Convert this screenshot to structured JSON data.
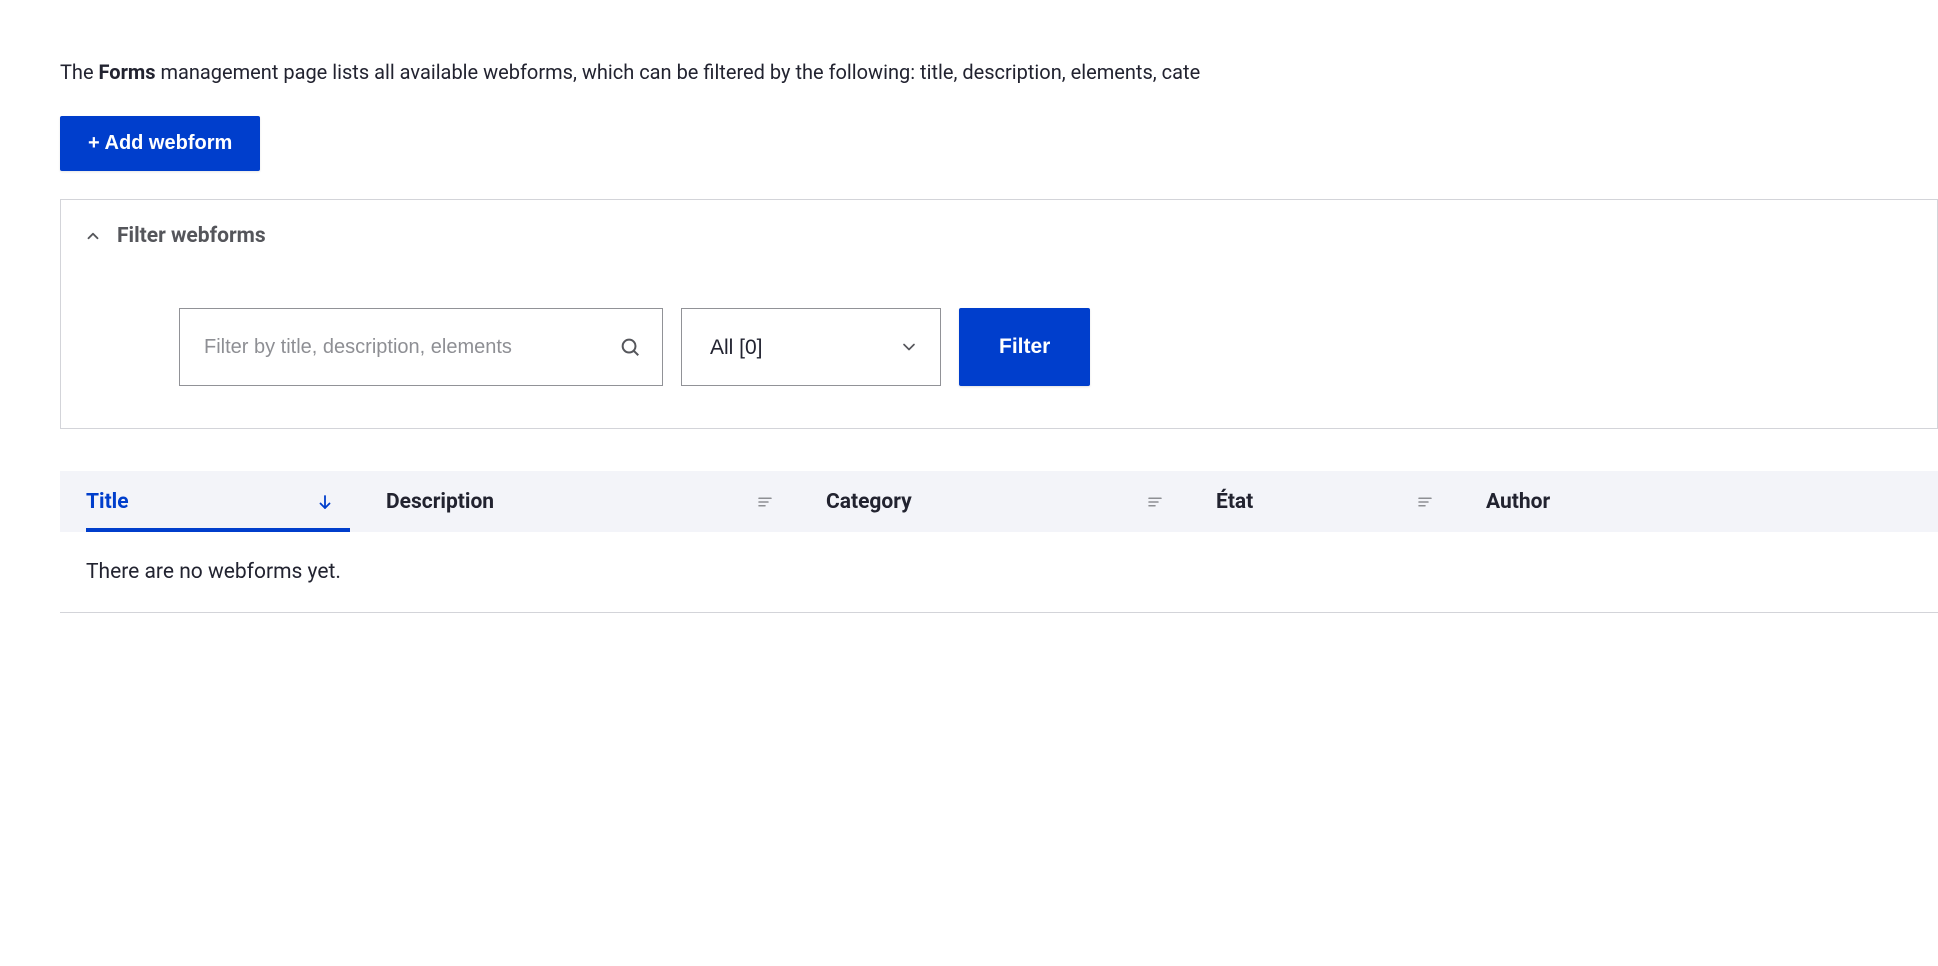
{
  "intro": {
    "prefix": "The ",
    "bold": "Forms",
    "suffix": " management page lists all available webforms, which can be filtered by the following: title, description, elements, cate"
  },
  "add_button": {
    "label": "+ Add webform"
  },
  "filter": {
    "summary": "Filter webforms",
    "search_placeholder": "Filter by title, description, elements",
    "select_value": "All [0]",
    "button": "Filter"
  },
  "table": {
    "headers": {
      "title": "Title",
      "description": "Description",
      "category": "Category",
      "etat": "État",
      "author": "Author"
    },
    "empty": "There are no webforms yet."
  }
}
